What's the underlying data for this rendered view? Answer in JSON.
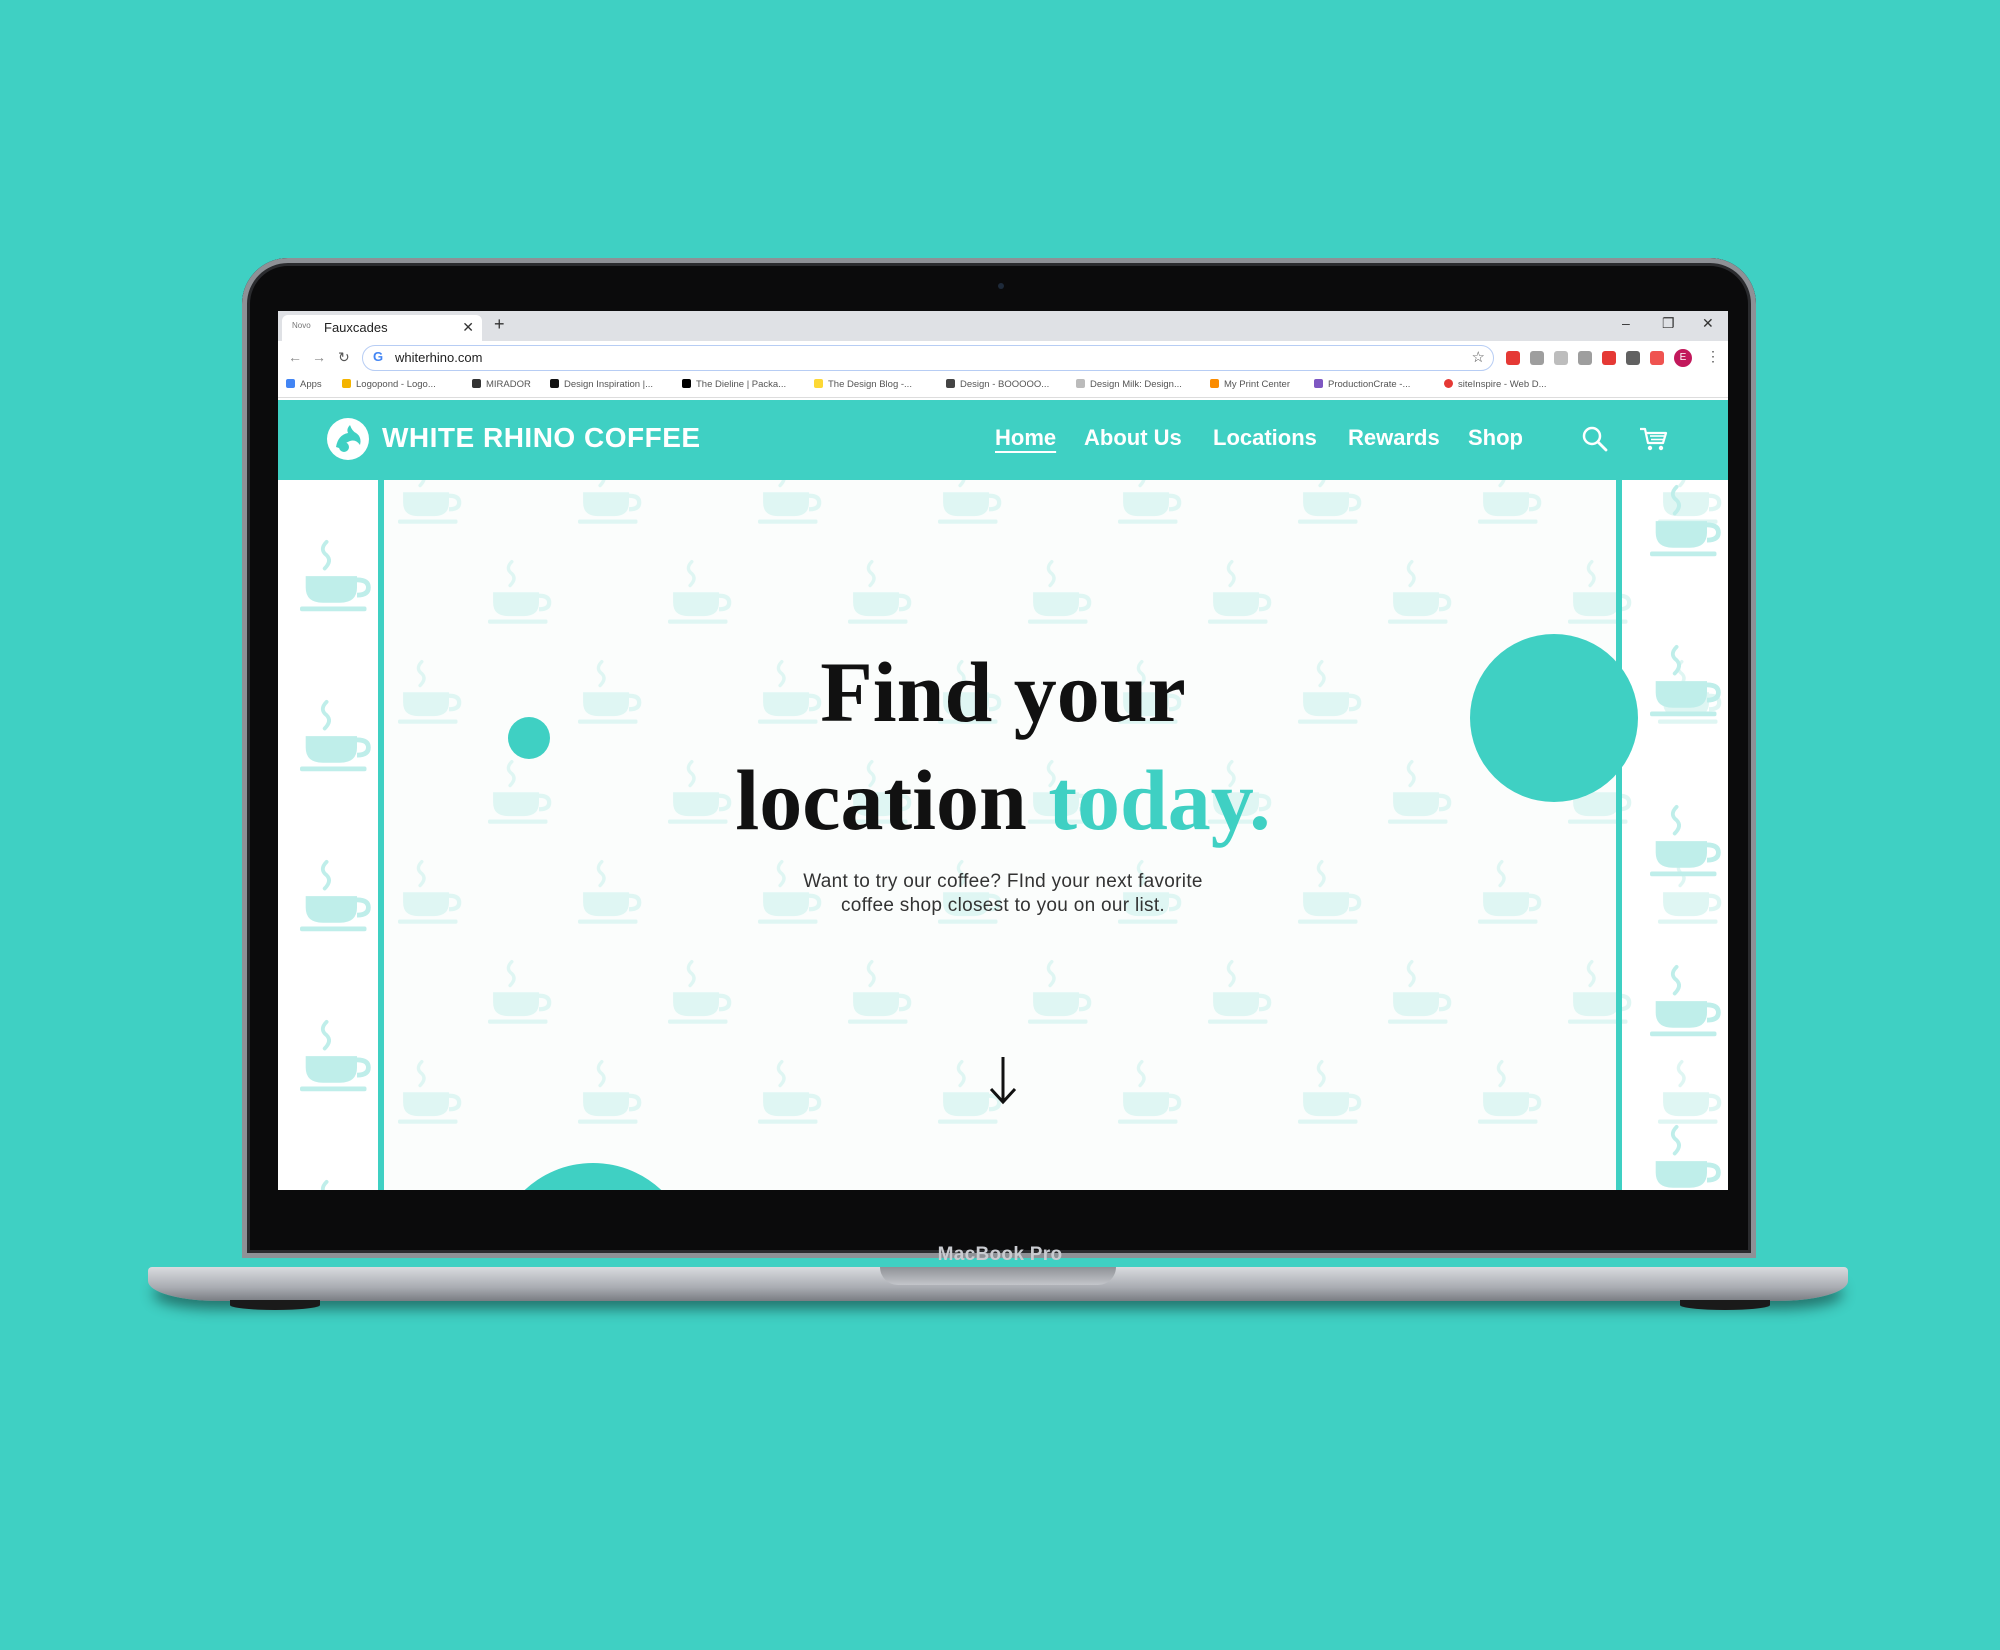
{
  "device": {
    "label": "MacBook Pro"
  },
  "browser": {
    "tab": {
      "title": "Fauxcades",
      "favicon_text": "Novo"
    },
    "new_tab_icon": "plus-icon",
    "url": "whiterhino.com",
    "window_controls": [
      "minimize-icon",
      "restore-icon",
      "close-icon"
    ],
    "profile_initial": "E",
    "bookmarks": [
      "Apps",
      "Logopond - Logo...",
      "MIRADOR",
      "Design Inspiration |...",
      "The Dieline | Packa...",
      "The Design Blog -...",
      "Design - BOOOOO...",
      "Design Milk: Design...",
      "My Print Center",
      "ProductionCrate -...",
      "siteInspire - Web D..."
    ]
  },
  "site": {
    "brand": "WHITE RHINO COFFEE",
    "nav": [
      {
        "label": "Home",
        "active": true
      },
      {
        "label": "About Us",
        "active": false
      },
      {
        "label": "Locations",
        "active": false
      },
      {
        "label": "Rewards",
        "active": false
      },
      {
        "label": "Shop",
        "active": false
      }
    ],
    "icons": [
      "search-icon",
      "cart-icon"
    ],
    "hero": {
      "headline_line1": "Find your",
      "headline_line2_plain": "location",
      "headline_line2_accent": "today.",
      "subtitle_line1": "Want to try our coffee? FInd your next favorite",
      "subtitle_line2": "coffee shop closest to you on our list.",
      "scroll_icon": "arrow-down-icon"
    },
    "colors": {
      "accent": "#3fd0c3",
      "text": "#111111",
      "background": "#3fd0c3"
    }
  }
}
